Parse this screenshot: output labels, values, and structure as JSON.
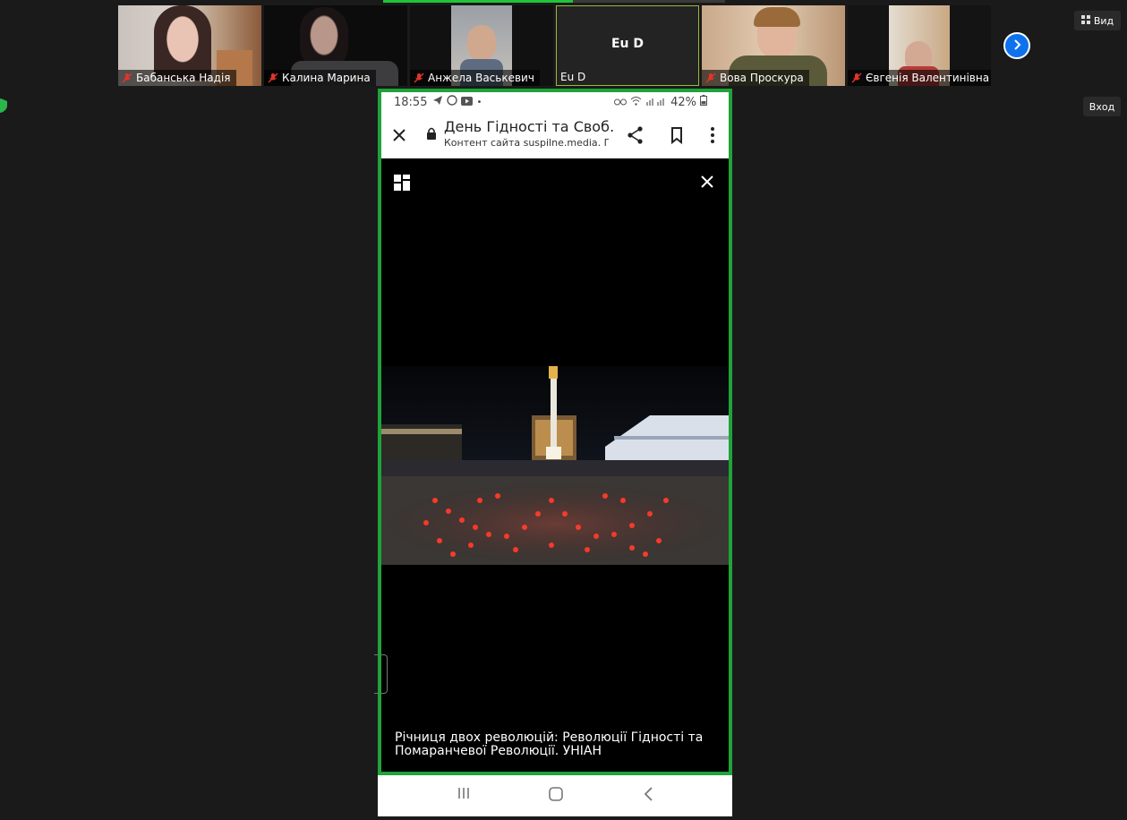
{
  "participants": [
    {
      "name": "Бабанська Надія",
      "muted": true
    },
    {
      "name": "Калина Марина",
      "muted": true
    },
    {
      "name": "Анжела Васькевич",
      "muted": true
    },
    {
      "name": "Eu D",
      "muted": false,
      "display": "Eu D"
    },
    {
      "name": "Вова Проскура",
      "muted": true
    },
    {
      "name": "Євгенія Валентинівна",
      "muted": true
    }
  ],
  "controls": {
    "view_label": "Вид",
    "enter_label": "Вход"
  },
  "phone": {
    "status": {
      "time": "18:55",
      "battery": "42%"
    },
    "browser": {
      "title": "День Гідності та Своб…",
      "subtitle": "Контент сайта suspilne.media. П"
    },
    "caption": "Річниця двох революцій: Революції Гідності та Помаранчевої Революції. УНІАН"
  },
  "colors": {
    "share_border": "#1fa33a",
    "accent_blue": "#0e72ed",
    "mute_red": "#e0352b"
  }
}
